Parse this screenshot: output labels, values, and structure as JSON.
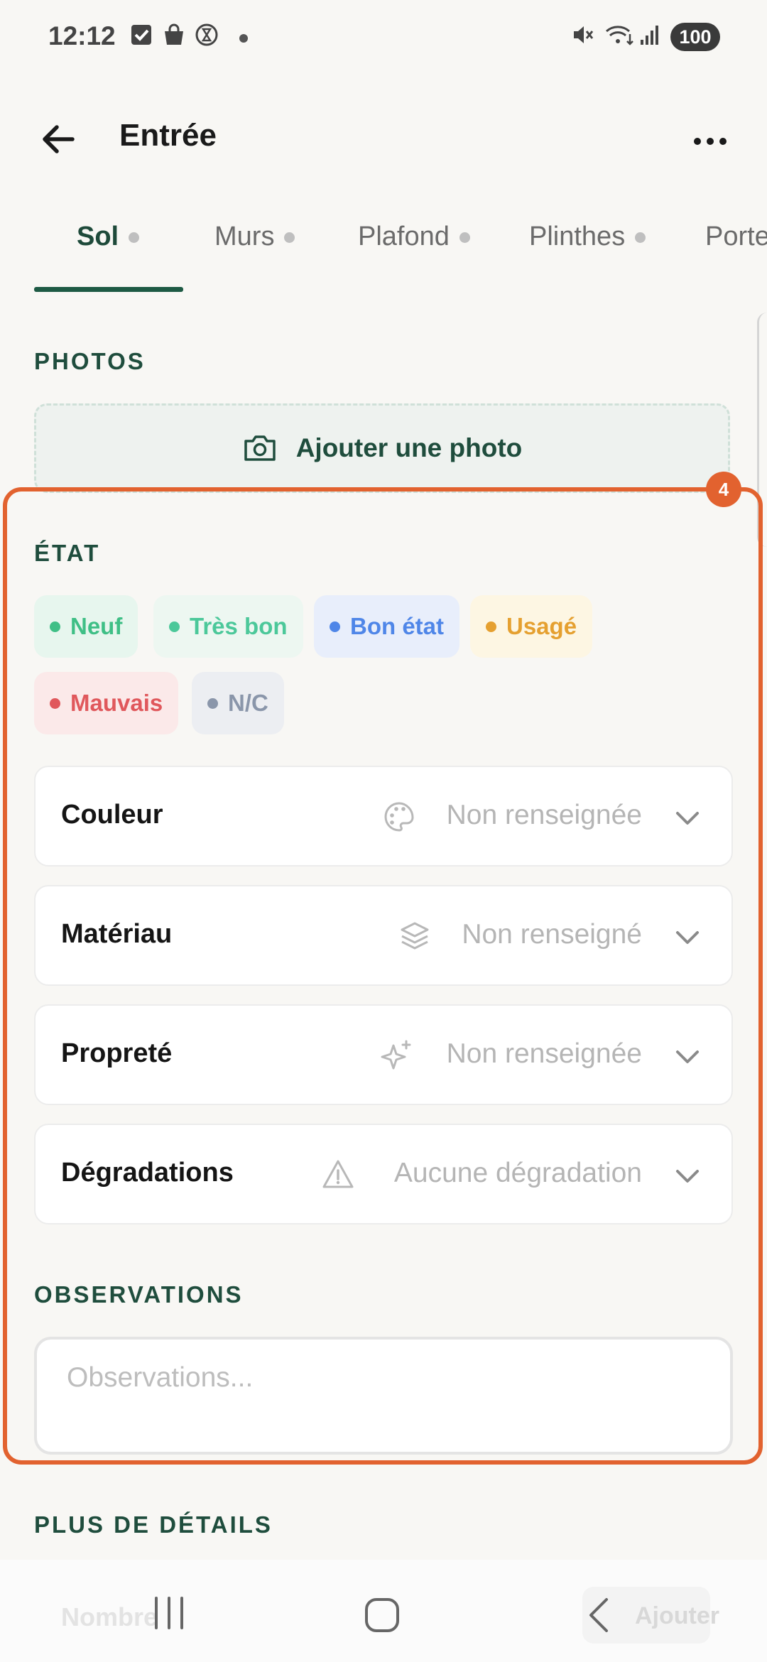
{
  "status_bar": {
    "time": "12:12",
    "battery": "100",
    "icons": [
      "checkbox-icon",
      "shopping-bag-icon",
      "hourglass-icon",
      "dot-icon",
      "mute-icon",
      "wifi-icon",
      "signal-icon"
    ]
  },
  "header": {
    "title": "Entrée",
    "back_icon": "back-arrow-icon",
    "more_icon": "more-options-icon"
  },
  "tabs": [
    {
      "label": "Sol",
      "active": true
    },
    {
      "label": "Murs",
      "active": false
    },
    {
      "label": "Plafond",
      "active": false
    },
    {
      "label": "Plinthes",
      "active": false
    },
    {
      "label": "Portes",
      "active": false
    }
  ],
  "photos": {
    "section_title": "PHOTOS",
    "add_label": "Ajouter une photo",
    "icon": "camera-icon"
  },
  "highlight_badge": "4",
  "etat": {
    "section_title": "ÉTAT",
    "chips": [
      {
        "label": "Neuf",
        "color": "#3fbf86",
        "bg": "#e7f6ee"
      },
      {
        "label": "Très bon",
        "color": "#4cc89a",
        "bg": "#edf7f1"
      },
      {
        "label": "Bon état",
        "color": "#4f86e8",
        "bg": "#e8eefb"
      },
      {
        "label": "Usagé",
        "color": "#e5a030",
        "bg": "#fdf6e3"
      },
      {
        "label": "Mauvais",
        "color": "#e0585c",
        "bg": "#fbe9e9"
      },
      {
        "label": "N/C",
        "color": "#8a96aa",
        "bg": "#eceef2"
      }
    ]
  },
  "fields": [
    {
      "label": "Couleur",
      "value": "Non renseignée",
      "icon": "palette-icon"
    },
    {
      "label": "Matériau",
      "value": "Non renseigné",
      "icon": "layers-icon"
    },
    {
      "label": "Propreté",
      "value": "Non renseignée",
      "icon": "sparkles-icon"
    },
    {
      "label": "Dégradations",
      "value": "Aucune dégradation",
      "icon": "warning-icon"
    }
  ],
  "observations": {
    "section_title": "OBSERVATIONS",
    "placeholder": "Observations..."
  },
  "more_details": {
    "section_title": "PLUS DE DÉTAILS"
  },
  "bottom_bar": {
    "left_label": "Nombre",
    "right_label": "Ajouter"
  },
  "nav": [
    "recent-apps-icon",
    "home-icon",
    "back-icon"
  ],
  "colors": {
    "accent": "#1f4d3d",
    "highlight": "#e2622f"
  }
}
